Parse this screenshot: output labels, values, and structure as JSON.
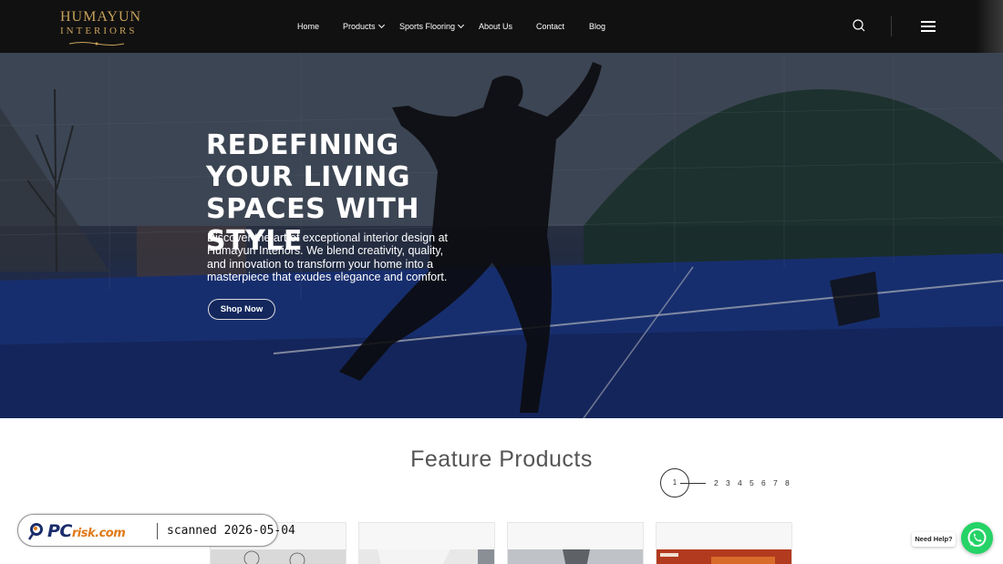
{
  "header": {
    "logo_line1": "HUMAYUN",
    "logo_line2": "INTERIORS",
    "nav": [
      {
        "label": "Home"
      },
      {
        "label": "Products"
      },
      {
        "label": "Sports Flooring"
      },
      {
        "label": "About Us"
      },
      {
        "label": "Contact"
      },
      {
        "label": "Blog"
      }
    ],
    "search_icon": "search-icon",
    "menu_icon": "hamburger-menu-icon"
  },
  "hero": {
    "title": "REDEFINING YOUR LIVING SPACES WITH STYLE",
    "text": "Discover the art of exceptional interior design at Humayun Interiors. We blend creativity, quality, and innovation to transform your home into a masterpiece that exudes elegance and comfort.",
    "button": "Shop Now"
  },
  "feature": {
    "title": "Feature Products",
    "pager": {
      "current": "1",
      "pages": [
        "2",
        "3",
        "4",
        "5",
        "6",
        "7",
        "8"
      ]
    }
  },
  "watermark": {
    "brand_main": "PC",
    "brand_sub": "risk.com",
    "scan_text": "scanned 2026-05-04"
  },
  "help": {
    "label": "Need Help?",
    "icon": "whatsapp-icon"
  },
  "colors": {
    "header_bg": "#111111",
    "logo_gold": "#c9a15a",
    "whatsapp_green": "#25d366"
  }
}
